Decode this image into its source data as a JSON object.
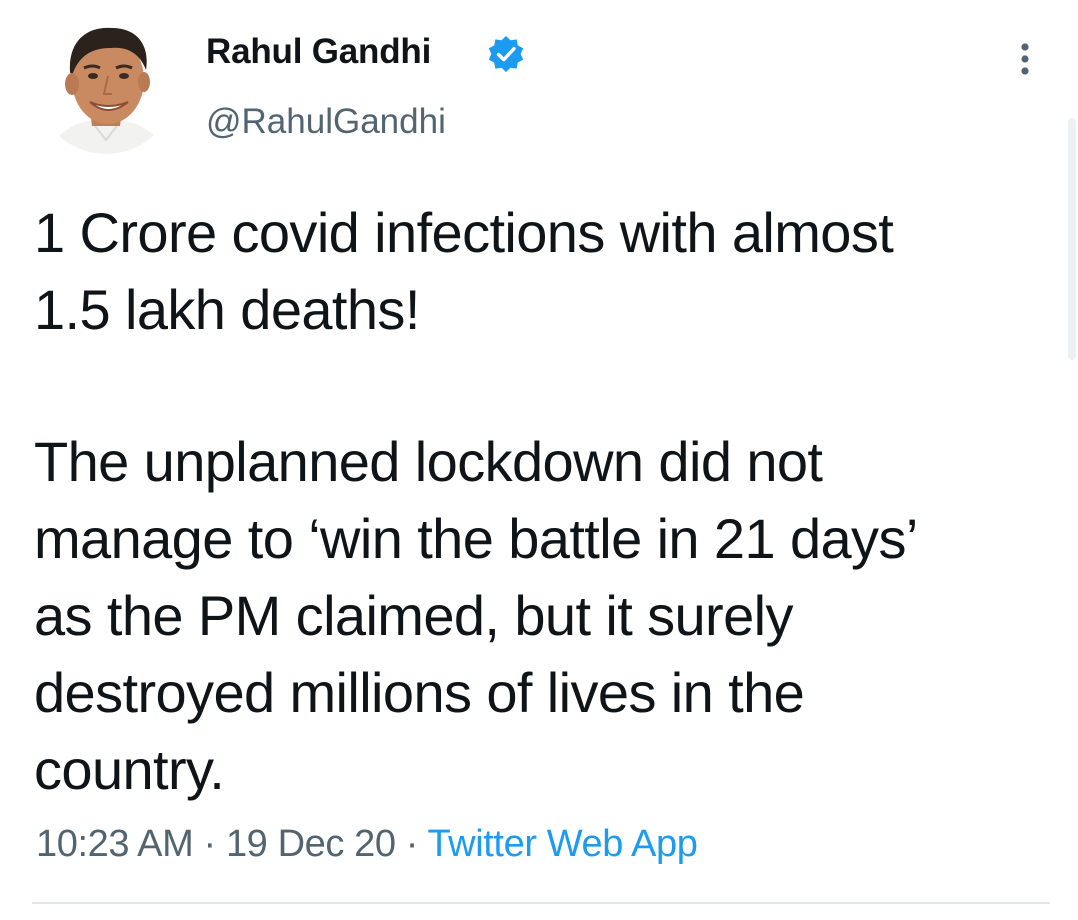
{
  "author": {
    "display_name": "Rahul Gandhi",
    "handle": "@RahulGandhi",
    "verified_icon": "verified-badge-icon",
    "avatar": "profile-photo"
  },
  "more_menu_icon": "more-vertical-icon",
  "tweet": {
    "paragraph1": [
      "1 Crore covid infections with almost",
      "1.5 lakh deaths!"
    ],
    "paragraph2": [
      "The unplanned lockdown did not",
      "manage to ‘win the battle in 21 days’",
      "as the PM claimed, but it surely",
      "destroyed millions of lives in the",
      "country."
    ]
  },
  "meta": {
    "time": "10:23 AM",
    "separator": " · ",
    "date": "19 Dec 20",
    "source": "Twitter Web App"
  },
  "colors": {
    "text": "#0f1419",
    "secondary": "#536471",
    "accent": "#1d9bf0"
  }
}
